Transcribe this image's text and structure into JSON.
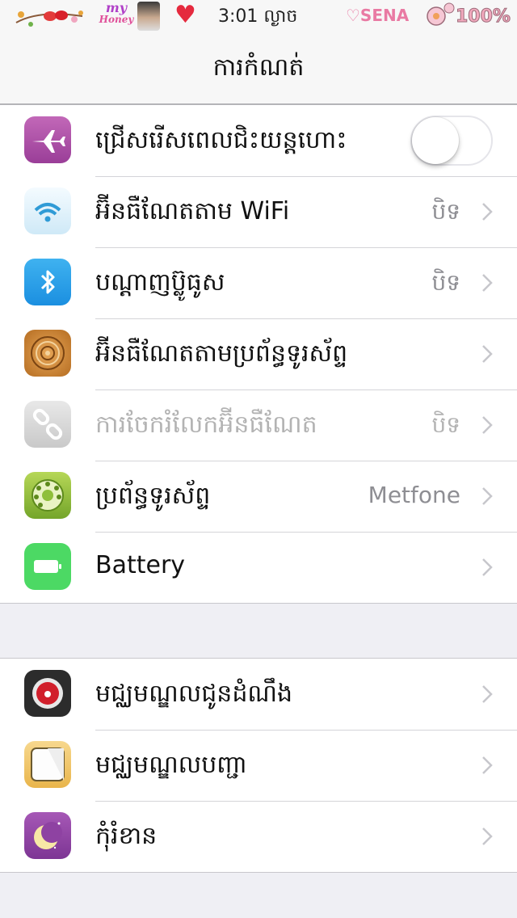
{
  "status_bar": {
    "sticker_left_icon": "birds-on-branch-sticker",
    "my_text": "my",
    "honey_text": "Honey",
    "avatar_icon": "profile-photo",
    "heart_icon": "heart",
    "time": "3:01 ល្ងាច",
    "sena_text": "♡SENA",
    "battery_text": "100%",
    "battery_icon": "flower-battery"
  },
  "nav": {
    "title": "ការកំណត់"
  },
  "group1": [
    {
      "label": "ជ្រើសរើសពេលជិះយន្តហោះ",
      "icon": "airplane-icon",
      "control": "toggle",
      "toggle_on": false
    },
    {
      "label": "អ៊ីនធឺណែតតាម WiFi",
      "value": "បិទ",
      "icon": "wifi-icon"
    },
    {
      "label": "បណ្ដាញប៊្លូធូស",
      "value": "បិទ",
      "icon": "bluetooth-icon"
    },
    {
      "label": "អ៊ីនធឺណែតតាមប្រព័ន្ធទូរស័ព្ទ",
      "icon": "cellular-data-icon"
    },
    {
      "label": "ការចែករំលែកអ៊ីនធឺណែត",
      "value": "បិទ",
      "icon": "personal-hotspot-icon",
      "dimmed": true
    },
    {
      "label": "ប្រព័ន្ធទូរស័ព្ទ",
      "value": "Metfone",
      "icon": "carrier-icon"
    },
    {
      "label": "Battery",
      "icon": "battery-icon"
    }
  ],
  "group2": [
    {
      "label": "មជ្ឈមណ្ឌលជូនដំណឹង",
      "icon": "notification-center-icon"
    },
    {
      "label": "មជ្ឈមណ្ឌលបញ្ជា",
      "icon": "control-center-icon"
    },
    {
      "label": "កុំរំខាន",
      "icon": "do-not-disturb-icon"
    }
  ],
  "colors": {
    "background": "#efeff4",
    "row_background": "#ffffff",
    "value_text": "#8e8e93",
    "dimmed_text": "#b3b3b3",
    "chevron": "#c7c7cc",
    "heart": "#e52a3e"
  }
}
